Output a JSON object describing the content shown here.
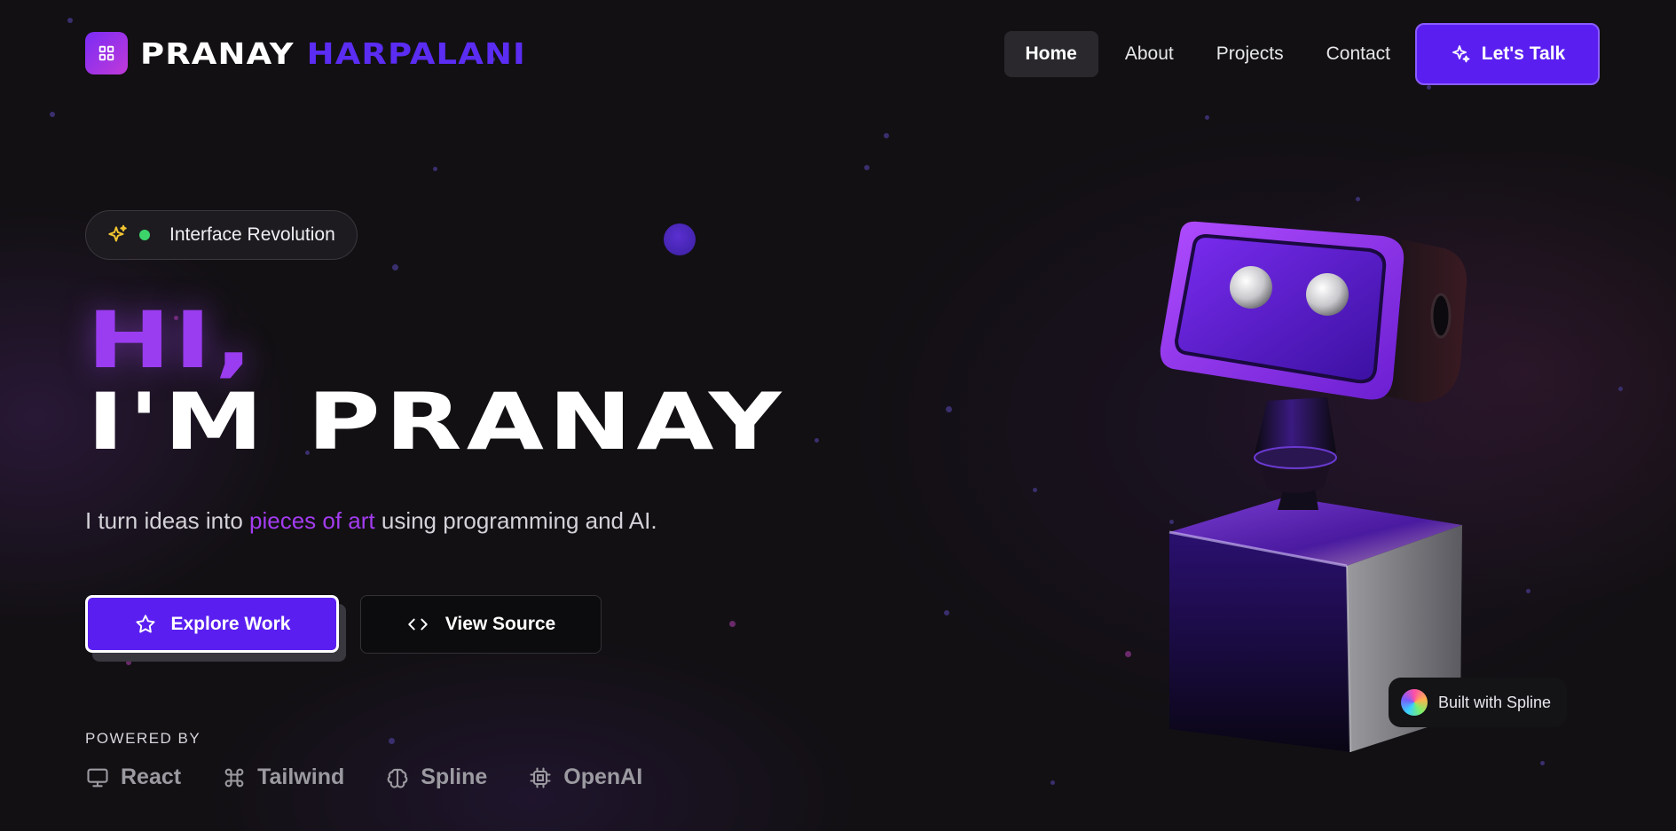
{
  "brand": {
    "first": "PRANAY",
    "last": "HARPALANI",
    "icon": "grid-icon"
  },
  "nav": {
    "items": [
      {
        "label": "Home",
        "active": true
      },
      {
        "label": "About",
        "active": false
      },
      {
        "label": "Projects",
        "active": false
      },
      {
        "label": "Contact",
        "active": false
      }
    ],
    "cta": {
      "label": "Let's Talk",
      "icon": "sparkles-icon"
    }
  },
  "hero": {
    "badge": {
      "label": "Interface Revolution",
      "icon": "sparkles-icon",
      "status_color": "#3dd36b"
    },
    "greeting": "HI,",
    "name": "I'M PRANAY",
    "tagline": {
      "before": "I turn ideas into ",
      "highlight": "pieces of art",
      "after": " using programming and AI."
    },
    "primary_button": {
      "label": "Explore Work",
      "icon": "star-icon"
    },
    "secondary_button": {
      "label": "View Source",
      "icon": "code-icon"
    }
  },
  "powered_by": {
    "label": "POWERED BY",
    "items": [
      {
        "label": "React",
        "icon": "monitor-icon"
      },
      {
        "label": "Tailwind",
        "icon": "command-icon"
      },
      {
        "label": "Spline",
        "icon": "brain-icon"
      },
      {
        "label": "OpenAI",
        "icon": "cpu-icon"
      }
    ]
  },
  "spline_badge": {
    "label": "Built with Spline"
  },
  "colors": {
    "accent": "#5a1ff0",
    "highlight": "#a33cf0",
    "background": "#121013"
  }
}
